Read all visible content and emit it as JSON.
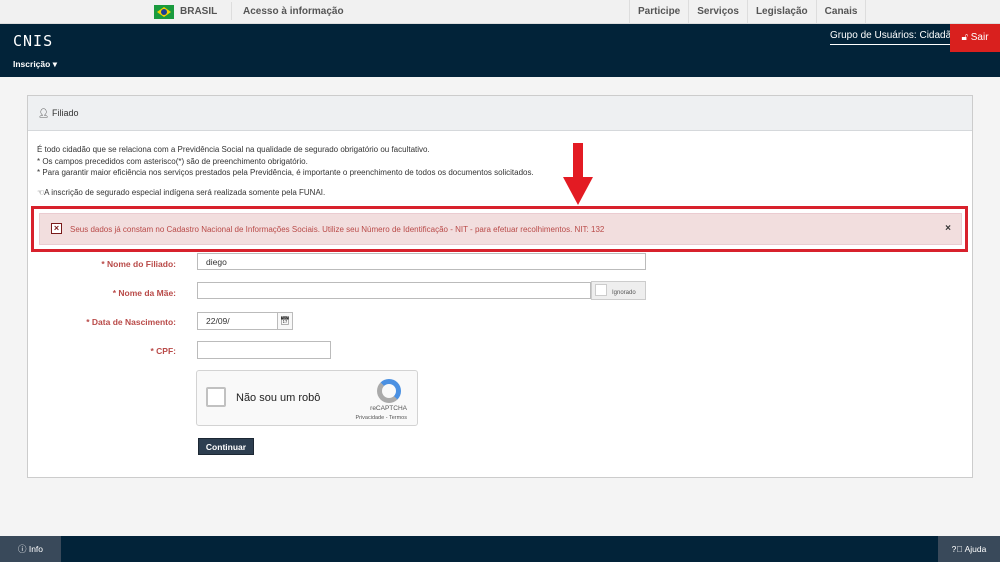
{
  "gov_bar": {
    "country": "BRASIL",
    "access": "Acesso à informação",
    "nav": [
      "Participe",
      "Serviços",
      "Legislação",
      "Canais"
    ]
  },
  "header": {
    "logo": "CNIS",
    "menu": "Inscrição",
    "user_group": "Grupo de Usuários: Cidadão",
    "logout": "Sair"
  },
  "panel": {
    "title": "Filiado",
    "intro": [
      "É todo cidadão que se relaciona com a Previdência Social na qualidade de segurado obrigatório ou facultativo.",
      "* Os campos precedidos com asterisco(*) são de preenchimento obrigatório.",
      "* Para garantir maior eficiência nos serviços prestados pela Previdência, é importante o preenchimento de todos os documentos solicitados."
    ],
    "funai_note": "A inscrição de segurado especial indígena será realizada somente pela FUNAI."
  },
  "alert": {
    "message": "Seus dados já constam no Cadastro Nacional de Informações Sociais. Utilize seu Número de Identificação - NIT - para efetuar recolhimentos. NIT: 132",
    "close": "×",
    "color": "#b94a48",
    "highlight_color": "#d8212c"
  },
  "form": {
    "nome_filiado": {
      "label": "* Nome do Filiado:",
      "value": "diego"
    },
    "nome_mae": {
      "label": "* Nome da Mãe:",
      "value": "",
      "ignored_label": "Ignorado"
    },
    "data_nascimento": {
      "label": "* Data de Nascimento:",
      "value": "22/09/"
    },
    "cpf": {
      "label": "* CPF:",
      "value": ""
    },
    "captcha": {
      "text": "Não sou um robô",
      "brand": "reCAPTCHA",
      "links": "Privacidade - Termos"
    },
    "submit": "Continuar"
  },
  "footer": {
    "info": "Info",
    "help": "Ajuda"
  }
}
